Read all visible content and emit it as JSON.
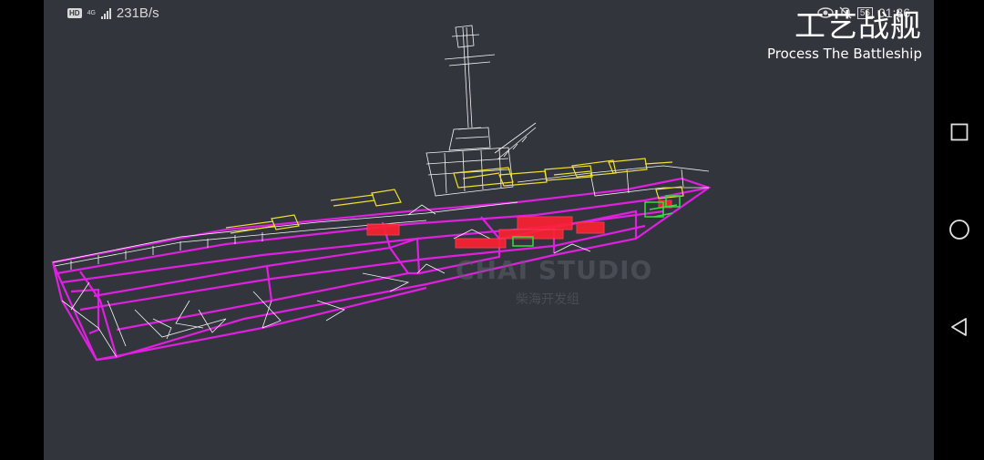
{
  "status_bar": {
    "hd_badge": "HD",
    "network_type": "4G",
    "net_speed": "231B/s",
    "battery": "56",
    "time": "01:36"
  },
  "app": {
    "title_zh": "工艺战舰",
    "title_en": "Process The Battleship"
  },
  "watermark": {
    "text": "CHAI STUDIO",
    "sub": "柴海开发组"
  },
  "navigation": {
    "recent_icon": "square-icon",
    "home_icon": "circle-icon",
    "back_icon": "triangle-back-icon"
  },
  "colors": {
    "background": "#32353c",
    "hull_wire": "#e020e0",
    "structure_wire": "#ffffff",
    "turret_wire": "#f0e030",
    "engine_block": "#ff2030",
    "machinery": "#30e040"
  }
}
